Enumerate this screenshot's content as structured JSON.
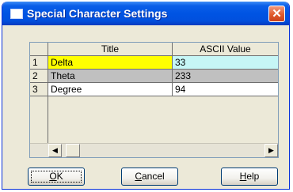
{
  "window": {
    "title": "Special Character Settings",
    "close_glyph": "✕"
  },
  "grid": {
    "columns": [
      "Title",
      "ASCII Value"
    ],
    "rows": [
      {
        "num": "1",
        "title": "Delta",
        "value": "33",
        "title_color": "#ffff00",
        "value_color": "#c6f6f6"
      },
      {
        "num": "2",
        "title": "Theta",
        "value": "233",
        "title_color": "#c0c0c0",
        "value_color": "#c0c0c0"
      },
      {
        "num": "3",
        "title": "Degree",
        "value": "94",
        "title_color": "#ffffff",
        "value_color": "#ffffff"
      }
    ],
    "scroll_left_glyph": "◀",
    "scroll_right_glyph": "▶"
  },
  "buttons": {
    "ok": {
      "hotkey": "O",
      "rest": "K"
    },
    "cancel": {
      "hotkey": "C",
      "rest": "ancel"
    },
    "help": {
      "hotkey": "H",
      "rest": "elp"
    }
  },
  "icons": {
    "title_icon": "window-icon",
    "close_icon": "close-icon"
  }
}
